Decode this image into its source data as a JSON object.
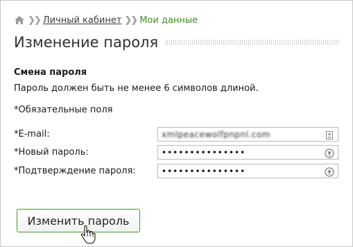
{
  "breadcrumb": {
    "home_icon": "home-icon",
    "separator_icon": "double-chevron-right-icon",
    "cabinet_link": "Личный кабинет",
    "current": "Мои данные"
  },
  "page": {
    "title": "Изменение пароля"
  },
  "section": {
    "title": "Смена пароля",
    "hint": "Пароль должен быть не менее 6 символов длиной.",
    "required_note": "*Обязательные поля"
  },
  "form": {
    "email_label": "*E-mail:",
    "email_value": "xmlpeacewolfpnpnl.com",
    "email_icon": "contact-card-icon",
    "new_password_label": "*Новый пароль:",
    "new_password_value": "•••••••••••••••",
    "confirm_password_label": "*Подтверждение пароля:",
    "confirm_password_value": "•••••••••••••••",
    "password_icon": "key-manager-icon",
    "submit_label": "Изменить пароль"
  },
  "colors": {
    "accent": "#3f8f25",
    "button_border": "#4a9a2b"
  },
  "cursor_icon": "hand-pointer-icon"
}
